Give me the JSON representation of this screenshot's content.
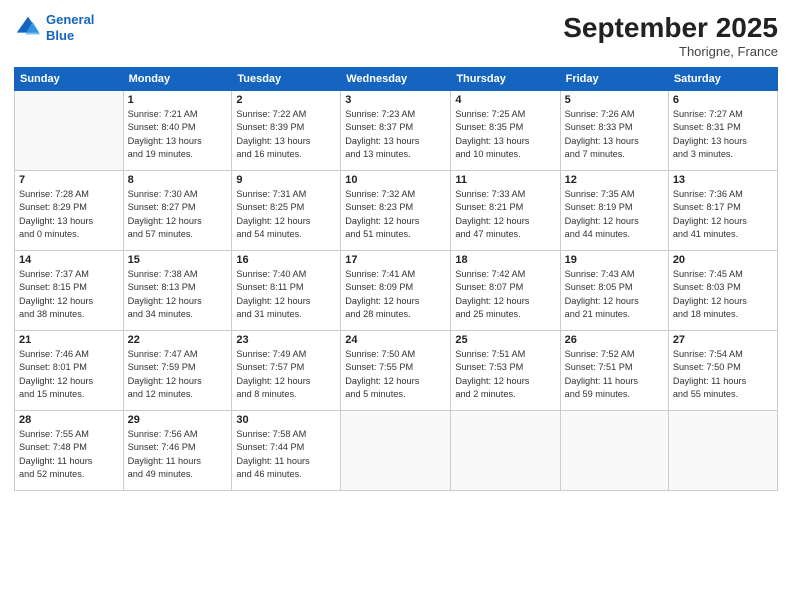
{
  "header": {
    "logo_line1": "General",
    "logo_line2": "Blue",
    "month": "September 2025",
    "location": "Thorigne, France"
  },
  "weekdays": [
    "Sunday",
    "Monday",
    "Tuesday",
    "Wednesday",
    "Thursday",
    "Friday",
    "Saturday"
  ],
  "weeks": [
    [
      {
        "day": "",
        "info": ""
      },
      {
        "day": "1",
        "info": "Sunrise: 7:21 AM\nSunset: 8:40 PM\nDaylight: 13 hours\nand 19 minutes."
      },
      {
        "day": "2",
        "info": "Sunrise: 7:22 AM\nSunset: 8:39 PM\nDaylight: 13 hours\nand 16 minutes."
      },
      {
        "day": "3",
        "info": "Sunrise: 7:23 AM\nSunset: 8:37 PM\nDaylight: 13 hours\nand 13 minutes."
      },
      {
        "day": "4",
        "info": "Sunrise: 7:25 AM\nSunset: 8:35 PM\nDaylight: 13 hours\nand 10 minutes."
      },
      {
        "day": "5",
        "info": "Sunrise: 7:26 AM\nSunset: 8:33 PM\nDaylight: 13 hours\nand 7 minutes."
      },
      {
        "day": "6",
        "info": "Sunrise: 7:27 AM\nSunset: 8:31 PM\nDaylight: 13 hours\nand 3 minutes."
      }
    ],
    [
      {
        "day": "7",
        "info": "Sunrise: 7:28 AM\nSunset: 8:29 PM\nDaylight: 13 hours\nand 0 minutes."
      },
      {
        "day": "8",
        "info": "Sunrise: 7:30 AM\nSunset: 8:27 PM\nDaylight: 12 hours\nand 57 minutes."
      },
      {
        "day": "9",
        "info": "Sunrise: 7:31 AM\nSunset: 8:25 PM\nDaylight: 12 hours\nand 54 minutes."
      },
      {
        "day": "10",
        "info": "Sunrise: 7:32 AM\nSunset: 8:23 PM\nDaylight: 12 hours\nand 51 minutes."
      },
      {
        "day": "11",
        "info": "Sunrise: 7:33 AM\nSunset: 8:21 PM\nDaylight: 12 hours\nand 47 minutes."
      },
      {
        "day": "12",
        "info": "Sunrise: 7:35 AM\nSunset: 8:19 PM\nDaylight: 12 hours\nand 44 minutes."
      },
      {
        "day": "13",
        "info": "Sunrise: 7:36 AM\nSunset: 8:17 PM\nDaylight: 12 hours\nand 41 minutes."
      }
    ],
    [
      {
        "day": "14",
        "info": "Sunrise: 7:37 AM\nSunset: 8:15 PM\nDaylight: 12 hours\nand 38 minutes."
      },
      {
        "day": "15",
        "info": "Sunrise: 7:38 AM\nSunset: 8:13 PM\nDaylight: 12 hours\nand 34 minutes."
      },
      {
        "day": "16",
        "info": "Sunrise: 7:40 AM\nSunset: 8:11 PM\nDaylight: 12 hours\nand 31 minutes."
      },
      {
        "day": "17",
        "info": "Sunrise: 7:41 AM\nSunset: 8:09 PM\nDaylight: 12 hours\nand 28 minutes."
      },
      {
        "day": "18",
        "info": "Sunrise: 7:42 AM\nSunset: 8:07 PM\nDaylight: 12 hours\nand 25 minutes."
      },
      {
        "day": "19",
        "info": "Sunrise: 7:43 AM\nSunset: 8:05 PM\nDaylight: 12 hours\nand 21 minutes."
      },
      {
        "day": "20",
        "info": "Sunrise: 7:45 AM\nSunset: 8:03 PM\nDaylight: 12 hours\nand 18 minutes."
      }
    ],
    [
      {
        "day": "21",
        "info": "Sunrise: 7:46 AM\nSunset: 8:01 PM\nDaylight: 12 hours\nand 15 minutes."
      },
      {
        "day": "22",
        "info": "Sunrise: 7:47 AM\nSunset: 7:59 PM\nDaylight: 12 hours\nand 12 minutes."
      },
      {
        "day": "23",
        "info": "Sunrise: 7:49 AM\nSunset: 7:57 PM\nDaylight: 12 hours\nand 8 minutes."
      },
      {
        "day": "24",
        "info": "Sunrise: 7:50 AM\nSunset: 7:55 PM\nDaylight: 12 hours\nand 5 minutes."
      },
      {
        "day": "25",
        "info": "Sunrise: 7:51 AM\nSunset: 7:53 PM\nDaylight: 12 hours\nand 2 minutes."
      },
      {
        "day": "26",
        "info": "Sunrise: 7:52 AM\nSunset: 7:51 PM\nDaylight: 11 hours\nand 59 minutes."
      },
      {
        "day": "27",
        "info": "Sunrise: 7:54 AM\nSunset: 7:50 PM\nDaylight: 11 hours\nand 55 minutes."
      }
    ],
    [
      {
        "day": "28",
        "info": "Sunrise: 7:55 AM\nSunset: 7:48 PM\nDaylight: 11 hours\nand 52 minutes."
      },
      {
        "day": "29",
        "info": "Sunrise: 7:56 AM\nSunset: 7:46 PM\nDaylight: 11 hours\nand 49 minutes."
      },
      {
        "day": "30",
        "info": "Sunrise: 7:58 AM\nSunset: 7:44 PM\nDaylight: 11 hours\nand 46 minutes."
      },
      {
        "day": "",
        "info": ""
      },
      {
        "day": "",
        "info": ""
      },
      {
        "day": "",
        "info": ""
      },
      {
        "day": "",
        "info": ""
      }
    ]
  ]
}
